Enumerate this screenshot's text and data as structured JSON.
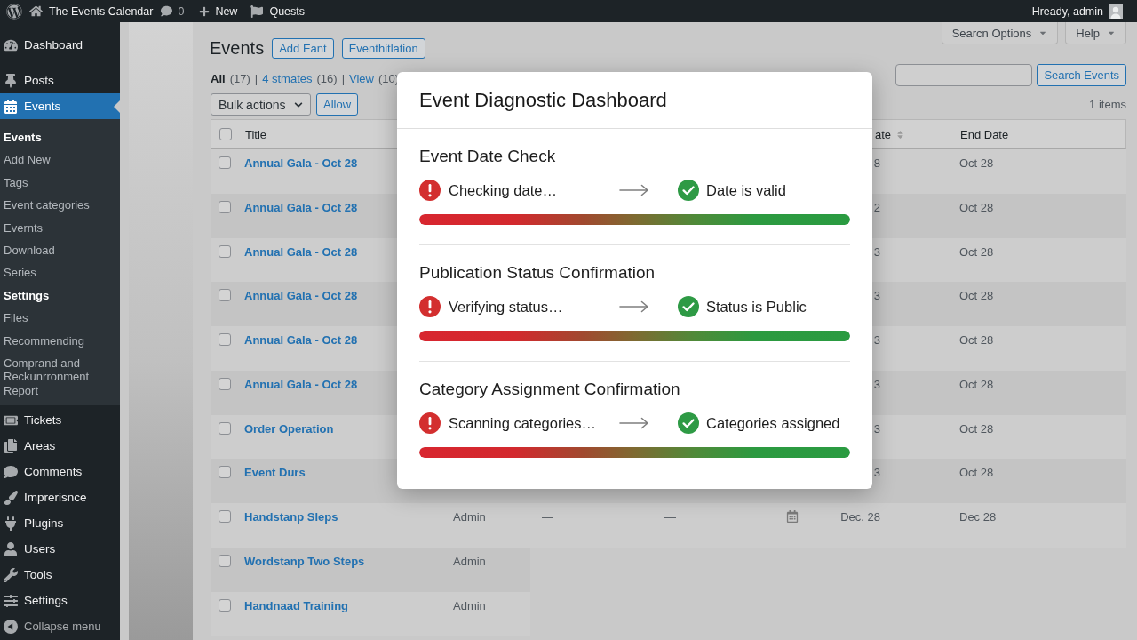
{
  "admin_bar": {
    "site_name": "The Events Calendar",
    "comment_count": "0",
    "new_label": "New",
    "quests_label": "Quests",
    "greeting": "Hready, admin"
  },
  "sidebar": {
    "items": [
      {
        "label": "Dashboard",
        "selected": false
      },
      {
        "label": "Posts",
        "selected": false
      },
      {
        "label": "Events",
        "selected": true,
        "children": [
          {
            "label": "Events",
            "current": true
          },
          {
            "label": "Add New",
            "current": false
          },
          {
            "label": "Tags",
            "current": false
          },
          {
            "label": "Event categories",
            "current": false
          },
          {
            "label": "Evernts",
            "current": false
          },
          {
            "label": "Download",
            "current": false
          },
          {
            "label": "Series",
            "current": false
          },
          {
            "label": "Settings",
            "current": true
          },
          {
            "label": "Files",
            "current": false
          },
          {
            "label": "Recommending",
            "current": false
          },
          {
            "label": "Comprand and Reckunrronment Report",
            "current": false
          }
        ]
      },
      {
        "label": "Tickets",
        "selected": false
      },
      {
        "label": "Areas",
        "selected": false
      },
      {
        "label": "Comments",
        "selected": false
      },
      {
        "label": "Imprerisnce",
        "selected": false
      },
      {
        "label": "Plugins",
        "selected": false
      },
      {
        "label": "Users",
        "selected": false
      },
      {
        "label": "Tools",
        "selected": false
      },
      {
        "label": "Settings",
        "selected": false
      }
    ],
    "collapse_label": "Collapse menu"
  },
  "screen_tabs": [
    {
      "label": "Searcn Options"
    },
    {
      "label": "Help"
    }
  ],
  "page": {
    "title": "Events",
    "header_buttons": [
      "Add Eant",
      "Eventhitlation"
    ],
    "views": [
      {
        "label": "All",
        "count": "(17)",
        "selected": true
      },
      {
        "separator": "|",
        "label": "4 stmates",
        "count": "(16)",
        "selected": false
      },
      {
        "separator": "|",
        "label": "View",
        "count": "(10)",
        "selected": false
      }
    ],
    "bulk_actions": "Bulk actions",
    "apply_button": "Allow",
    "search_button": "Search Events",
    "items_count": "1 items"
  },
  "table": {
    "select_all": {
      "checked": false
    },
    "columns": [
      {
        "label": "Title",
        "sortable": false
      },
      {
        "label": "ate",
        "sortable": true
      },
      {
        "label": "End Date",
        "sortable": false
      }
    ],
    "rows": [
      {
        "title": "Annual Gala - Oct 28",
        "checked": false,
        "start_date": "8",
        "end_date": "Oct 28"
      },
      {
        "title": "Annual Gala - Oct 28",
        "checked": false,
        "start_date": "2",
        "end_date": "Oct 28"
      },
      {
        "title": "Annual Gala - Oct 28",
        "checked": false,
        "start_date": "3",
        "end_date": "Oct 28"
      },
      {
        "title": "Annual Gala - Oct 28",
        "checked": false,
        "start_date": "3",
        "end_date": "Oct 28"
      },
      {
        "title": "Annual Gala - Oct 28",
        "checked": false,
        "start_date": "3",
        "end_date": "Oct 28"
      },
      {
        "title": "Annual Gala - Oct 28",
        "checked": false,
        "start_date": "3",
        "end_date": "Oct 28"
      },
      {
        "title": "Order Operation",
        "checked": false,
        "start_date": "3",
        "end_date": "Oct 28"
      },
      {
        "title": "Event Durs",
        "checked": false,
        "start_date": "3",
        "end_date": "Oct 28"
      },
      {
        "title": "Handstanp Sleps",
        "checked": false,
        "author": "Admin",
        "column_3": "—",
        "column_4": "—",
        "start_date": "Dec. 28",
        "end_date": "Dec 28"
      },
      {
        "title": "Wordstanp Two Steps",
        "checked": false,
        "author": "Admin"
      },
      {
        "title": "Handnaad Training",
        "checked": false,
        "author": "Admin"
      }
    ]
  },
  "dialog": {
    "title": "Event Diagnostic Dashboard",
    "checks": [
      {
        "heading": "Event Date Check",
        "from": {
          "text": "Checking date…",
          "ok": false
        },
        "to": {
          "text": "Date is valid",
          "ok": true
        },
        "level": 1
      },
      {
        "heading": "Publication Status Confirmation",
        "from": {
          "text": "Verifying status…",
          "ok": false
        },
        "to": {
          "text": "Status is Public",
          "ok": true
        },
        "level": 1
      },
      {
        "heading": "Category Assignment Confirmation",
        "from": {
          "text": "Scanning categories…",
          "ok": false
        },
        "to": {
          "text": "Categories assigned",
          "ok": true
        },
        "level": 1
      }
    ]
  }
}
